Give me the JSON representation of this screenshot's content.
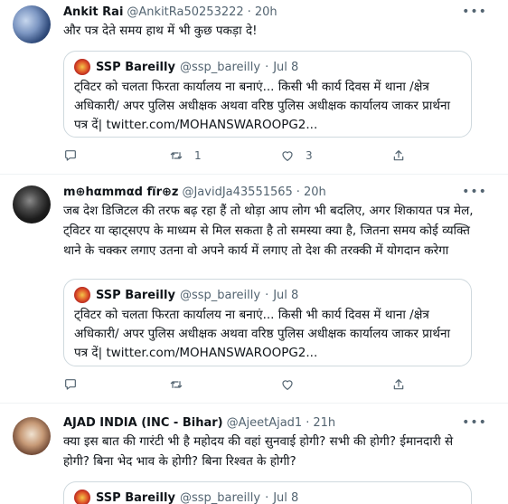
{
  "tweets": [
    {
      "name": "Ankit Rai",
      "handle": "@AnkitRa50253222",
      "time": "20h",
      "text": "और पत्र देते समय  हाथ में भी कुछ पकड़ा दे!",
      "quote": {
        "name": "SSP Bareilly",
        "handle": "@ssp_bareilly",
        "time": "Jul 8",
        "text": "ट्विटर को चलता फिरता कार्यालय ना बनाएं... किसी भी कार्य दिवस में थाना /क्षेत्र अधिकारी/ अपर पुलिस अधीक्षक अथवा वरिष्ठ पुलिस अधीक्षक कार्यालय जाकर प्रार्थना पत्र दें|",
        "link": "twitter.com/MOHANSWAROOPG2..."
      },
      "actions": {
        "replies": "",
        "retweets": "1",
        "likes": "3"
      }
    },
    {
      "name": "m⊕hαmmαd fïr⊕z",
      "handle": "@JavidJa43551565",
      "time": "20h",
      "text": "जब देश डिजिटल की तरफ बढ़ रहा हैं तो थोड़ा आप लोग भी बदलिए, अगर शिकायत पत्र मेल, ट्विटर या व्हाट्सएप के माध्यम से मिल सकता है तो समस्या क्या है, जितना समय कोई व्यक्ति थाने के चक्कर लगाए उतना वो अपने कार्य में लगाए तो देश की तरक्की में योगदान करेगा",
      "quote": {
        "name": "SSP Bareilly",
        "handle": "@ssp_bareilly",
        "time": "Jul 8",
        "text": "ट्विटर को चलता फिरता कार्यालय ना बनाएं... किसी भी कार्य दिवस में थाना /क्षेत्र अधिकारी/ अपर पुलिस अधीक्षक अथवा वरिष्ठ पुलिस अधीक्षक कार्यालय जाकर प्रार्थना पत्र दें|",
        "link": "twitter.com/MOHANSWAROOPG2..."
      },
      "actions": {
        "replies": "",
        "retweets": "",
        "likes": ""
      }
    },
    {
      "name": "AJAD INDIA (INC - Bihar)",
      "handle": "@AjeetAjad1",
      "time": "21h",
      "text": "क्या इस बात की गारंटी भी है महोदय की वहां सुनवाई होगी? सभी की होगी? ईमानदारी से होगी? बिना भेद भाव के होगी? बिना रिश्वत के होगी?",
      "quote": {
        "name": "SSP Bareilly",
        "handle": "@ssp_bareilly",
        "time": "Jul 8"
      }
    }
  ],
  "icons": {
    "more": "more-icon",
    "reply": "reply-icon",
    "retweet": "retweet-icon",
    "like": "like-icon",
    "share": "share-icon"
  },
  "colors": {
    "text": "#0f1419",
    "secondary": "#536471",
    "border": "#cfd9de",
    "divider": "#eff3f4"
  }
}
